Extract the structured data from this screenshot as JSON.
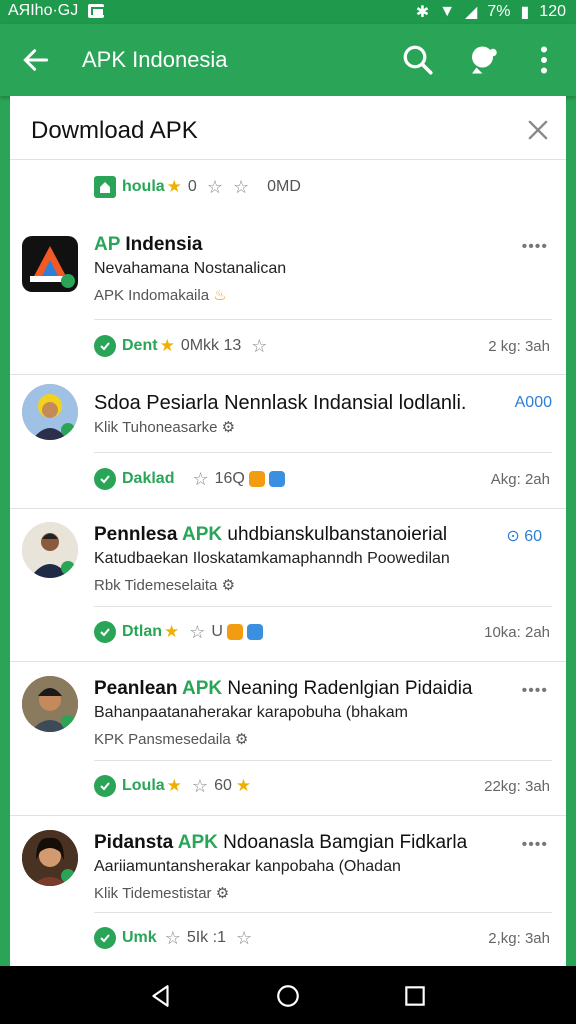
{
  "status_bar": {
    "left_text": "AЯIho·GJ",
    "battery": "7%",
    "time": "120"
  },
  "app_bar": {
    "title": "APK Indonesia",
    "back_icon": "arrow-left-icon",
    "search_icon": "search-icon",
    "account_icon": "account-icon",
    "menu_icon": "more-vert-icon"
  },
  "sheet": {
    "title": "Dowmload APK",
    "close_icon": "close-icon"
  },
  "top_meta": {
    "label": "houla",
    "rating": "0",
    "extra": "0MD"
  },
  "items": [
    {
      "title_a": "AP",
      "title_b": " Indensia",
      "subtitle": "Nevahamana Nostanalican",
      "source": "APK Indomakaila",
      "meta_label": "Dent",
      "meta_text": "0Mkk 13",
      "time": "2 kg: 3ah"
    },
    {
      "title": "Sdoa Pesiarla Nennlask Indansial lodlanli.",
      "tag": "A000",
      "subtitle": "Klik Tuhoneasarke",
      "meta_label": "Daklad",
      "meta_text": "16Q",
      "time": "Akg: 2ah"
    },
    {
      "title_a": "Pennlesa ",
      "title_b": "APK",
      "title_c": " uhdbianskulbanstanoierial",
      "tag": "⊙ 60",
      "subtitle": "Katudbaekan Iloskatamkamaphanndh Poowedilan",
      "source": "Rbk Tidemeselaita",
      "meta_label": "Dtlan",
      "meta_text": "U",
      "time": "10ka: 2ah"
    },
    {
      "title_a": "Peanlean ",
      "title_b": "APK",
      "title_c": " Neaning Radenlgian Pidaidia",
      "subtitle": "Bahanpaatanaherakar karapobuha (bhakam",
      "source": "KPK Pansmesedaila",
      "meta_label": "Loula",
      "meta_text": "60",
      "time": "22kg: 3ah"
    },
    {
      "title_a": "Pidansta ",
      "title_b": "APK",
      "title_c": " Ndoanasla Bamgian Fidkarla",
      "subtitle": "Aariiamuntansherakar kanpobaha (Ohadan",
      "source": "Klik Tidemestistar",
      "meta_label": "Umk",
      "meta_text": "5Ik :1",
      "time": "2,kg: 3ah"
    }
  ],
  "nav": {
    "back": "nav-back-icon",
    "home": "nav-home-icon",
    "recents": "nav-recents-icon"
  }
}
